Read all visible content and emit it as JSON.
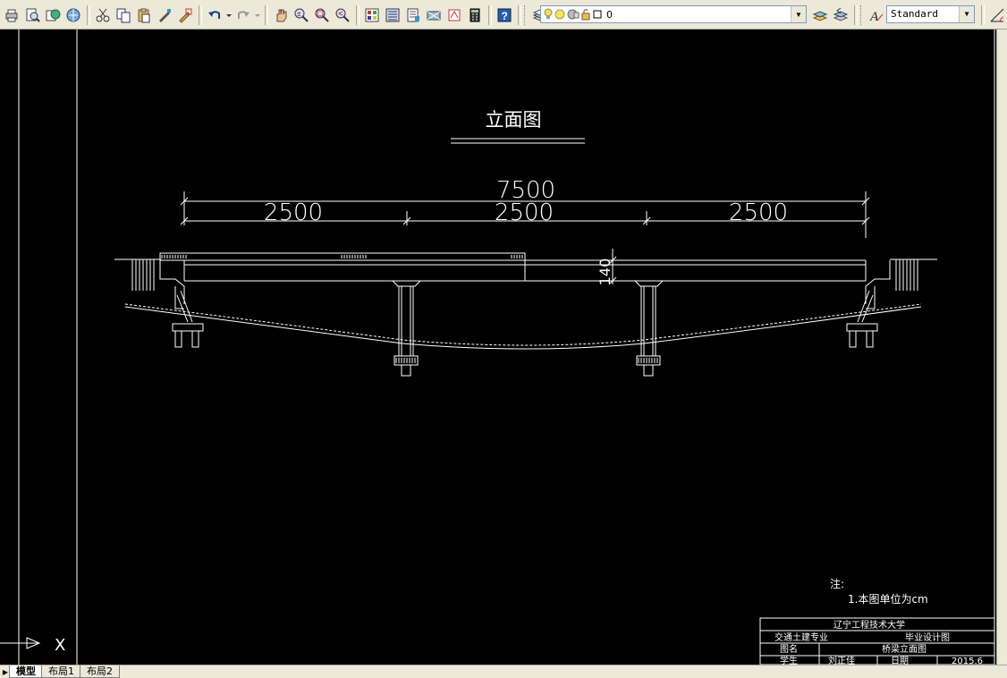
{
  "toolbar": {
    "standard_buttons": [
      "plot-icon",
      "plot-preview-icon",
      "publish-icon",
      "3d-dwf-icon",
      "cut-icon",
      "copy-icon",
      "paste-icon",
      "match-properties-icon",
      "block-editor-icon",
      "undo-icon",
      "redo-icon",
      "pan-icon",
      "zoom-realtime-icon",
      "zoom-window-icon",
      "zoom-previous-icon",
      "properties-icon",
      "design-center-icon",
      "tool-palettes-icon",
      "sheet-set-icon",
      "markup-icon",
      "quickcalc-icon",
      "help-icon"
    ],
    "layer_value": "0",
    "text_style_value": "Standard"
  },
  "drawing": {
    "title": "立面图",
    "overall_dimension": "7500",
    "span_dimensions": [
      "2500",
      "2500",
      "2500"
    ],
    "height_dimension": "140",
    "notes_heading": "注:",
    "notes_line": "1.本图单位为cm",
    "title_block": {
      "university": "辽宁工程技术大学",
      "major": "交通土建专业",
      "design_type": "毕业设计图",
      "drawing_name_label": "图名",
      "drawing_name": "桥梁立面图",
      "student_label": "学生",
      "student": "刘正佳",
      "date_label": "日期",
      "date": "2015.6"
    },
    "ucs_x_label": "X"
  },
  "tabs": {
    "model": "模型",
    "layout1": "布局1",
    "layout2": "布局2"
  }
}
